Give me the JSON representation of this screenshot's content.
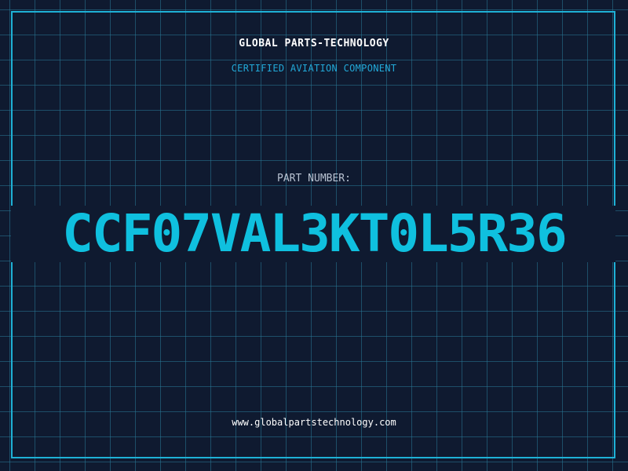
{
  "company": "GLOBAL PARTS-TECHNOLOGY",
  "subtitle": "CERTIFIED AVIATION COMPONENT",
  "part_label": "PART NUMBER:",
  "part_number": "CCF07VAL3KT0L5R36",
  "website": "www.globalpartstechnology.com",
  "colors": {
    "background": "#0f1a30",
    "grid": "#287896",
    "frame": "#1eb1d6",
    "accent": "#0fc0df",
    "subtitle": "#22a9d8",
    "label": "#b9c3d2",
    "text": "#ffffff"
  }
}
